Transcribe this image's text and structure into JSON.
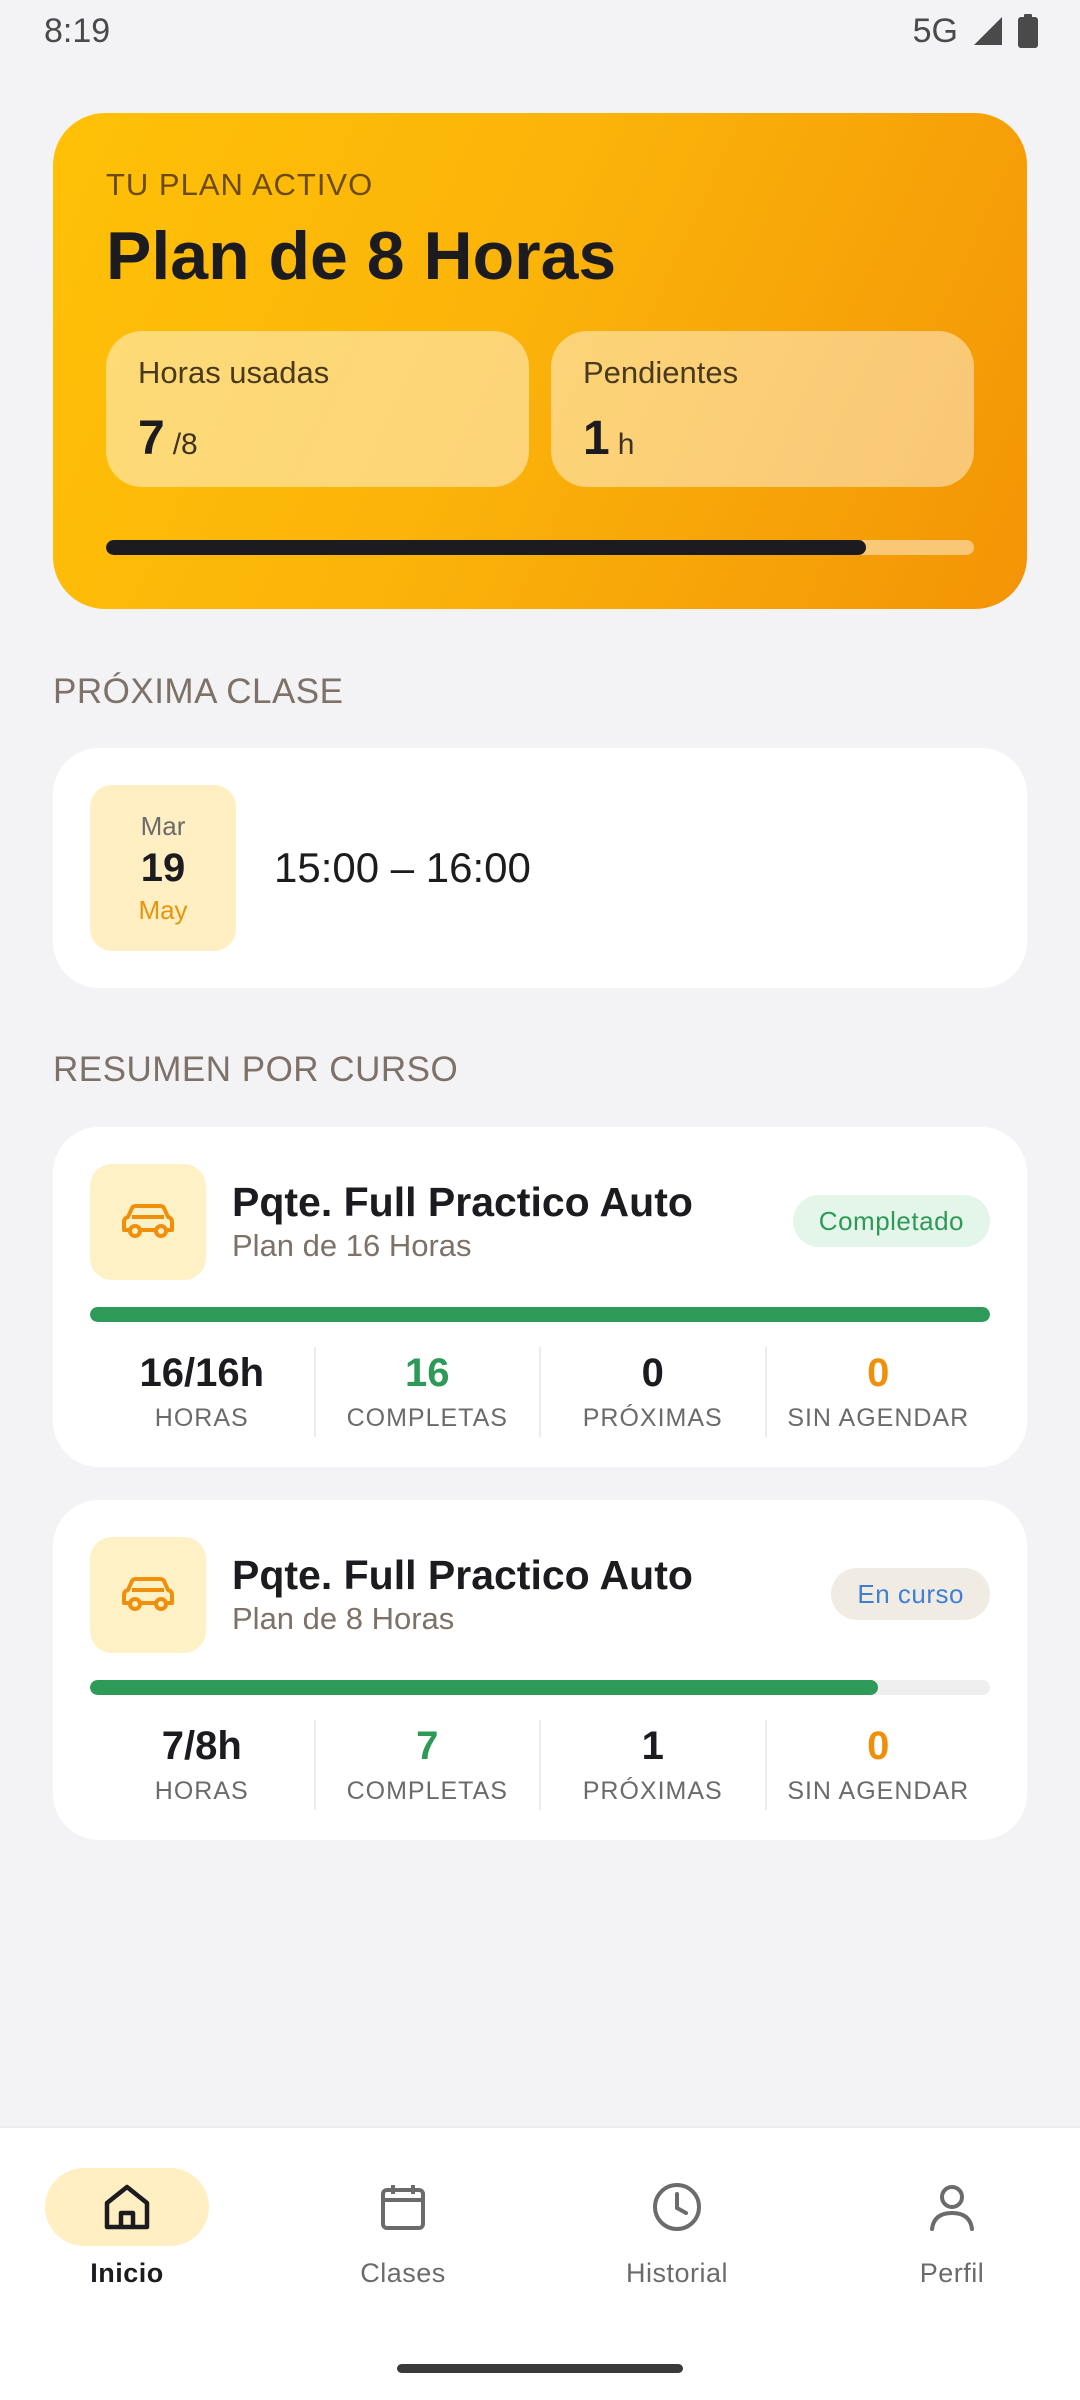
{
  "status_bar": {
    "time": "8:19",
    "network": "5G"
  },
  "plan": {
    "kicker": "TU PLAN ACTIVO",
    "title": "Plan de 8 Horas",
    "used": {
      "label": "Horas usadas",
      "value": "7",
      "suffix": "/8"
    },
    "pending": {
      "label": "Pendientes",
      "value": "1",
      "suffix": "h"
    },
    "progress": 0.875
  },
  "next_class": {
    "section_title": "PRÓXIMA CLASE",
    "day_of_week": "Mar",
    "day": "19",
    "month": "May",
    "time_range": "15:00 – 16:00"
  },
  "summary": {
    "section_title": "RESUMEN POR CURSO",
    "courses": [
      {
        "name": "Pqte. Full Practico Auto",
        "plan": "Plan de 16 Horas",
        "badge": "Completado",
        "progress": 1.0,
        "stats": {
          "horas": {
            "value": "16/16h",
            "label": "HORAS"
          },
          "completas": {
            "value": "16",
            "label": "COMPLETAS"
          },
          "proximas": {
            "value": "0",
            "label": "PRÓXIMAS"
          },
          "sin_agendar": {
            "value": "0",
            "label": "SIN AGENDAR"
          }
        }
      },
      {
        "name": "Pqte. Full Practico Auto",
        "plan": "Plan de 8 Horas",
        "badge": "En curso",
        "progress": 0.875,
        "stats": {
          "horas": {
            "value": "7/8h",
            "label": "HORAS"
          },
          "completas": {
            "value": "7",
            "label": "COMPLETAS"
          },
          "proximas": {
            "value": "1",
            "label": "PRÓXIMAS"
          },
          "sin_agendar": {
            "value": "0",
            "label": "SIN AGENDAR"
          }
        }
      }
    ]
  },
  "nav": {
    "items": [
      {
        "label": "Inicio",
        "icon": "home-icon",
        "active": true
      },
      {
        "label": "Clases",
        "icon": "calendar-icon",
        "active": false
      },
      {
        "label": "Historial",
        "icon": "clock-icon",
        "active": false
      },
      {
        "label": "Perfil",
        "icon": "person-icon",
        "active": false
      }
    ]
  },
  "colors": {
    "accent": "#ffc107",
    "accent_dark": "#f39406",
    "success": "#2e9a57",
    "warning": "#f0900a",
    "info": "#3f7fd6"
  }
}
